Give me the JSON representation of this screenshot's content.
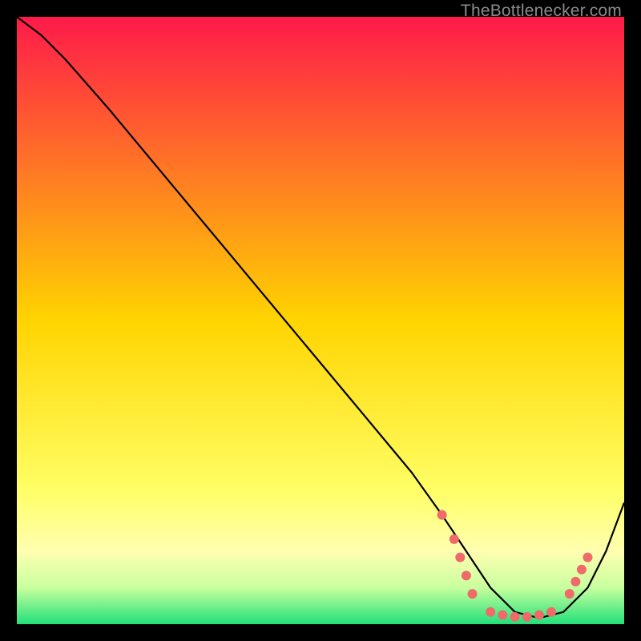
{
  "watermark": "TheBottleneсker.com",
  "chart_data": {
    "type": "line",
    "title": "",
    "xlabel": "",
    "ylabel": "",
    "xlim": [
      0,
      100
    ],
    "ylim": [
      0,
      100
    ],
    "background_gradient": [
      {
        "stop": 0.0,
        "color": "#ff1a4a"
      },
      {
        "stop": 0.5,
        "color": "#ffd400"
      },
      {
        "stop": 0.78,
        "color": "#ffff66"
      },
      {
        "stop": 0.88,
        "color": "#ffffb0"
      },
      {
        "stop": 0.94,
        "color": "#c8ff9e"
      },
      {
        "stop": 1.0,
        "color": "#22e07a"
      }
    ],
    "series": [
      {
        "name": "bottleneck-curve",
        "x": [
          0,
          4,
          8,
          15,
          25,
          35,
          45,
          55,
          65,
          70,
          74,
          78,
          82,
          86,
          90,
          94,
          97,
          100
        ],
        "y": [
          100,
          97,
          93,
          85,
          73,
          61,
          49,
          37,
          25,
          18,
          12,
          6,
          2,
          1,
          2,
          6,
          12,
          20
        ]
      }
    ],
    "markers": {
      "name": "highlight-dots",
      "color": "#f06a6a",
      "points": [
        {
          "x": 70,
          "y": 18
        },
        {
          "x": 72,
          "y": 14
        },
        {
          "x": 73,
          "y": 11
        },
        {
          "x": 74,
          "y": 8
        },
        {
          "x": 75,
          "y": 5
        },
        {
          "x": 78,
          "y": 2
        },
        {
          "x": 80,
          "y": 1.5
        },
        {
          "x": 82,
          "y": 1.2
        },
        {
          "x": 84,
          "y": 1.2
        },
        {
          "x": 86,
          "y": 1.5
        },
        {
          "x": 88,
          "y": 2
        },
        {
          "x": 91,
          "y": 5
        },
        {
          "x": 92,
          "y": 7
        },
        {
          "x": 93,
          "y": 9
        },
        {
          "x": 94,
          "y": 11
        }
      ]
    }
  }
}
